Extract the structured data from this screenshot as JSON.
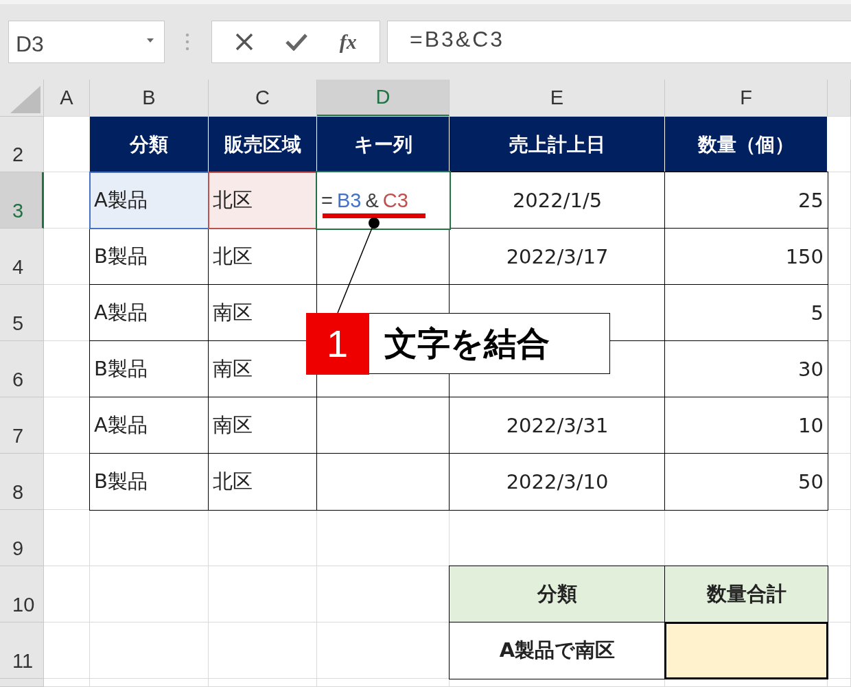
{
  "name_box": {
    "value": "D3"
  },
  "formula_bar": {
    "function_label": "fx",
    "formula": "=B3&C3"
  },
  "columns": [
    {
      "label": "A",
      "selected": false
    },
    {
      "label": "B",
      "selected": false
    },
    {
      "label": "C",
      "selected": false
    },
    {
      "label": "D",
      "selected": true
    },
    {
      "label": "E",
      "selected": false
    },
    {
      "label": "F",
      "selected": false
    }
  ],
  "rows": [
    {
      "label": "2",
      "selected": false
    },
    {
      "label": "3",
      "selected": true
    },
    {
      "label": "4",
      "selected": false
    },
    {
      "label": "5",
      "selected": false
    },
    {
      "label": "6",
      "selected": false
    },
    {
      "label": "7",
      "selected": false
    },
    {
      "label": "8",
      "selected": false
    },
    {
      "label": "9",
      "selected": false
    },
    {
      "label": "10",
      "selected": false
    },
    {
      "label": "11",
      "selected": false
    }
  ],
  "table": {
    "headers": [
      "分類",
      "販売区域",
      "キー列",
      "売上計上日",
      "数量（個）"
    ],
    "rows": [
      {
        "category": "A製品",
        "category_reference": {
          "color": "#4472c4"
        },
        "region": "北区",
        "region_reference": {
          "color": "#c0504d"
        },
        "key_formula": [
          {
            "text": "=",
            "color": "#404040"
          },
          {
            "text": "B3",
            "color": "#4472c4"
          },
          {
            "text": "&",
            "color": "#404040"
          },
          {
            "text": "C3",
            "color": "#c0504d"
          }
        ],
        "date": "2022/1/5",
        "quantity": "25"
      },
      {
        "category": "B製品",
        "region": "北区",
        "date": "2022/3/17",
        "quantity": "150"
      },
      {
        "category": "A製品",
        "region": "南区",
        "quantity": "5"
      },
      {
        "category": "B製品",
        "region": "南区",
        "quantity": "30"
      },
      {
        "category": "A製品",
        "region": "南区",
        "date": "2022/3/31",
        "quantity": "10"
      },
      {
        "category": "B製品",
        "region": "北区",
        "date": "2022/3/10",
        "quantity": "50"
      }
    ]
  },
  "summary": {
    "headers": [
      "分類",
      "数量合計"
    ],
    "label": "A製品で南区"
  },
  "callout": {
    "number": "1",
    "text": "文字を結合"
  }
}
